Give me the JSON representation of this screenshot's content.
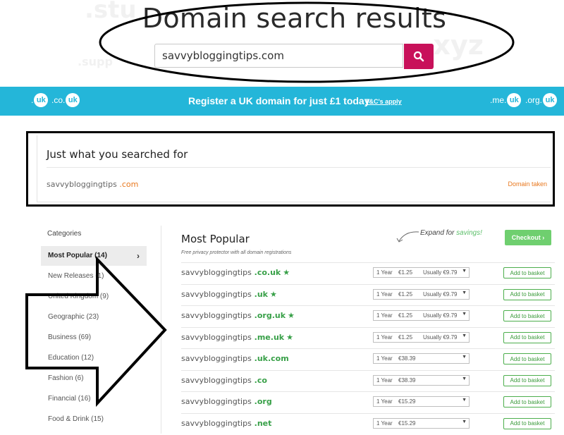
{
  "hero": {
    "title": "Domain search results",
    "ghost_words": [
      ".stu",
      ".xyz",
      ".supp"
    ],
    "search_value": "savvybloggingtips.com"
  },
  "promo": {
    "text": "Register a UK domain for just £1 today",
    "link": "T&C's apply",
    "tlds_left": [
      {
        "prefix": ".",
        "circle": "uk"
      },
      {
        "prefix": ".co.",
        "circle": "uk"
      }
    ],
    "tlds_right": [
      {
        "prefix": ".me.",
        "circle": "uk"
      },
      {
        "prefix": ".org.",
        "circle": "uk"
      }
    ]
  },
  "result": {
    "heading": "Just what you searched for",
    "domain_name": "savvybloggingtips",
    "domain_ext": " .com",
    "status": "Domain taken"
  },
  "sidebar": {
    "title": "Categories",
    "items": [
      {
        "label": "Most Popular (14)",
        "active": true
      },
      {
        "label": "New Releases (1)"
      },
      {
        "label": "United Kingdom (9)"
      },
      {
        "label": "Geographic (23)"
      },
      {
        "label": "Business (69)"
      },
      {
        "label": "Education (12)"
      },
      {
        "label": "Fashion (6)"
      },
      {
        "label": "Financial (16)"
      },
      {
        "label": "Food & Drink (15)"
      }
    ]
  },
  "main": {
    "title": "Most Popular",
    "subtitle": "Free privacy protector with all domain registrations",
    "expand_note": "Expand for",
    "expand_save": "savings!",
    "checkout_label": "Checkout ›",
    "add_label": "Add to basket",
    "rows": [
      {
        "name": "savvybloggingtips",
        "ext": " .co.uk",
        "star": true,
        "year": "1 Year",
        "price": "€1.25",
        "usually": "Usually €9.79"
      },
      {
        "name": "savvybloggingtips",
        "ext": " .uk",
        "star": true,
        "year": "1 Year",
        "price": "€1.25",
        "usually": "Usually €9.79"
      },
      {
        "name": "savvybloggingtips",
        "ext": " .org.uk",
        "star": true,
        "year": "1 Year",
        "price": "€1.25",
        "usually": "Usually €9.79"
      },
      {
        "name": "savvybloggingtips",
        "ext": " .me.uk",
        "star": true,
        "year": "1 Year",
        "price": "€1.25",
        "usually": "Usually €9.79"
      },
      {
        "name": "savvybloggingtips",
        "ext": " .uk.com",
        "star": false,
        "year": "1 Year",
        "price": "€38.39",
        "usually": ""
      },
      {
        "name": "savvybloggingtips",
        "ext": " .co",
        "star": false,
        "year": "1 Year",
        "price": "€38.39",
        "usually": ""
      },
      {
        "name": "savvybloggingtips",
        "ext": " .org",
        "star": false,
        "year": "1 Year",
        "price": "€15.29",
        "usually": ""
      },
      {
        "name": "savvybloggingtips",
        "ext": " .net",
        "star": false,
        "year": "1 Year",
        "price": "€15.29",
        "usually": ""
      }
    ]
  },
  "colors": {
    "accent_blue": "#24b6d9",
    "search_button": "#c8115a",
    "taken_orange": "#e8781e",
    "extension_green": "#38a048",
    "checkout_green": "#6fcf6f"
  }
}
